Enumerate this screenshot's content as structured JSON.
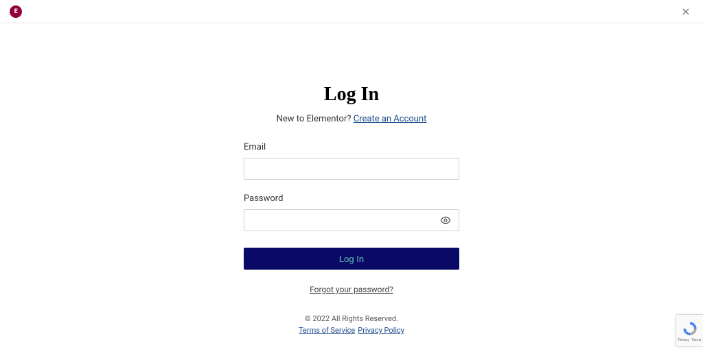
{
  "header": {
    "logo_text": "E"
  },
  "login": {
    "title": "Log In",
    "subtitle_prefix": "New to Elementor? ",
    "create_account_label": "Create an Account",
    "email_label": "Email",
    "password_label": "Password",
    "submit_label": "Log In",
    "forgot_label": "Forgot your password?"
  },
  "footer": {
    "copyright": "© 2022 All Rights Reserved.",
    "terms_label": "Terms of Service",
    "privacy_label": "Privacy Policy"
  },
  "recaptcha": {
    "line1": "Privacy · Terms"
  }
}
